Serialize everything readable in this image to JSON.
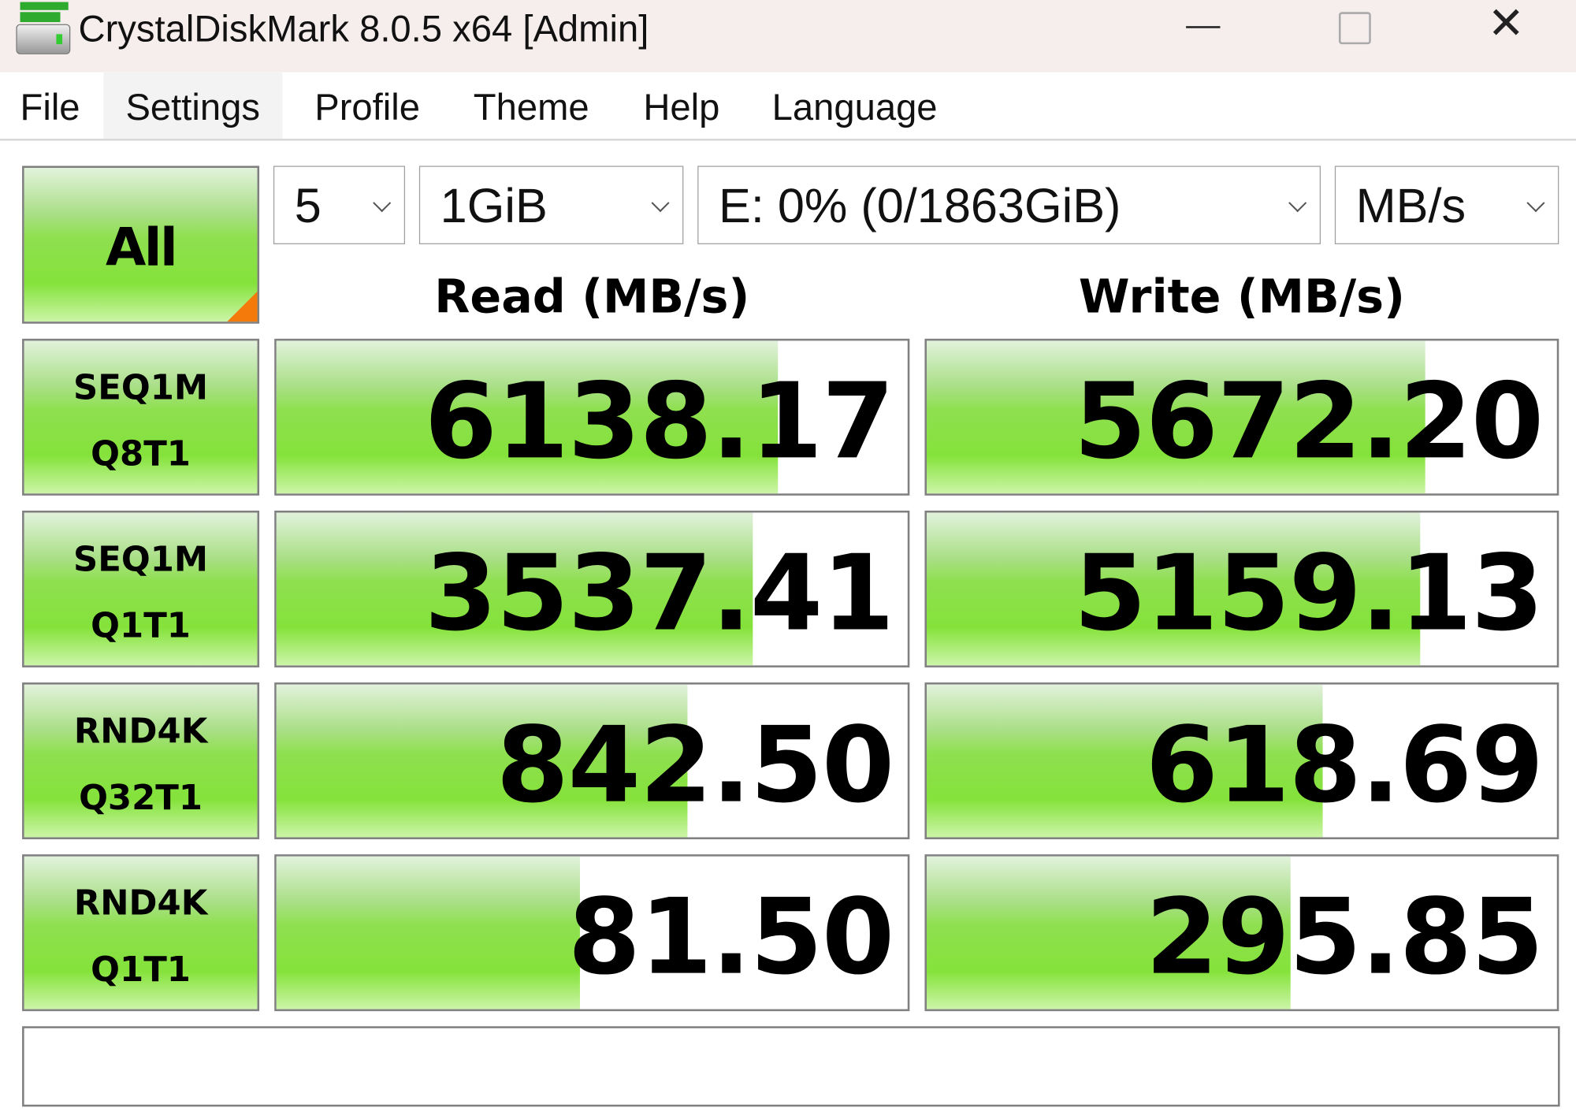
{
  "window": {
    "title": "CrystalDiskMark 8.0.5 x64 [Admin]"
  },
  "menu": [
    "File",
    "Settings",
    "Profile",
    "Theme",
    "Help",
    "Language"
  ],
  "controls": {
    "all_label": "All",
    "count": "5",
    "size": "1GiB",
    "drive": "E: 0% (0/1863GiB)",
    "unit": "MB/s"
  },
  "headers": {
    "read": "Read (MB/s)",
    "write": "Write (MB/s)"
  },
  "tests": [
    {
      "line1": "SEQ1M",
      "line2": "Q8T1",
      "read": "6138.17",
      "write": "5672.20",
      "read_fill": 0.794,
      "write_fill": 0.791
    },
    {
      "line1": "SEQ1M",
      "line2": "Q1T1",
      "read": "3537.41",
      "write": "5159.13",
      "read_fill": 0.755,
      "write_fill": 0.783
    },
    {
      "line1": "RND4K",
      "line2": "Q32T1",
      "read": "842.50",
      "write": "618.69",
      "read_fill": 0.652,
      "write_fill": 0.629
    },
    {
      "line1": "RND4K",
      "line2": "Q1T1",
      "read": "81.50",
      "write": "295.85",
      "read_fill": 0.481,
      "write_fill": 0.577
    }
  ],
  "comment": "",
  "colors": {
    "bar_green": "#84e23a",
    "corner_orange": "#f47a0c",
    "titlebar": "#f6eded"
  }
}
